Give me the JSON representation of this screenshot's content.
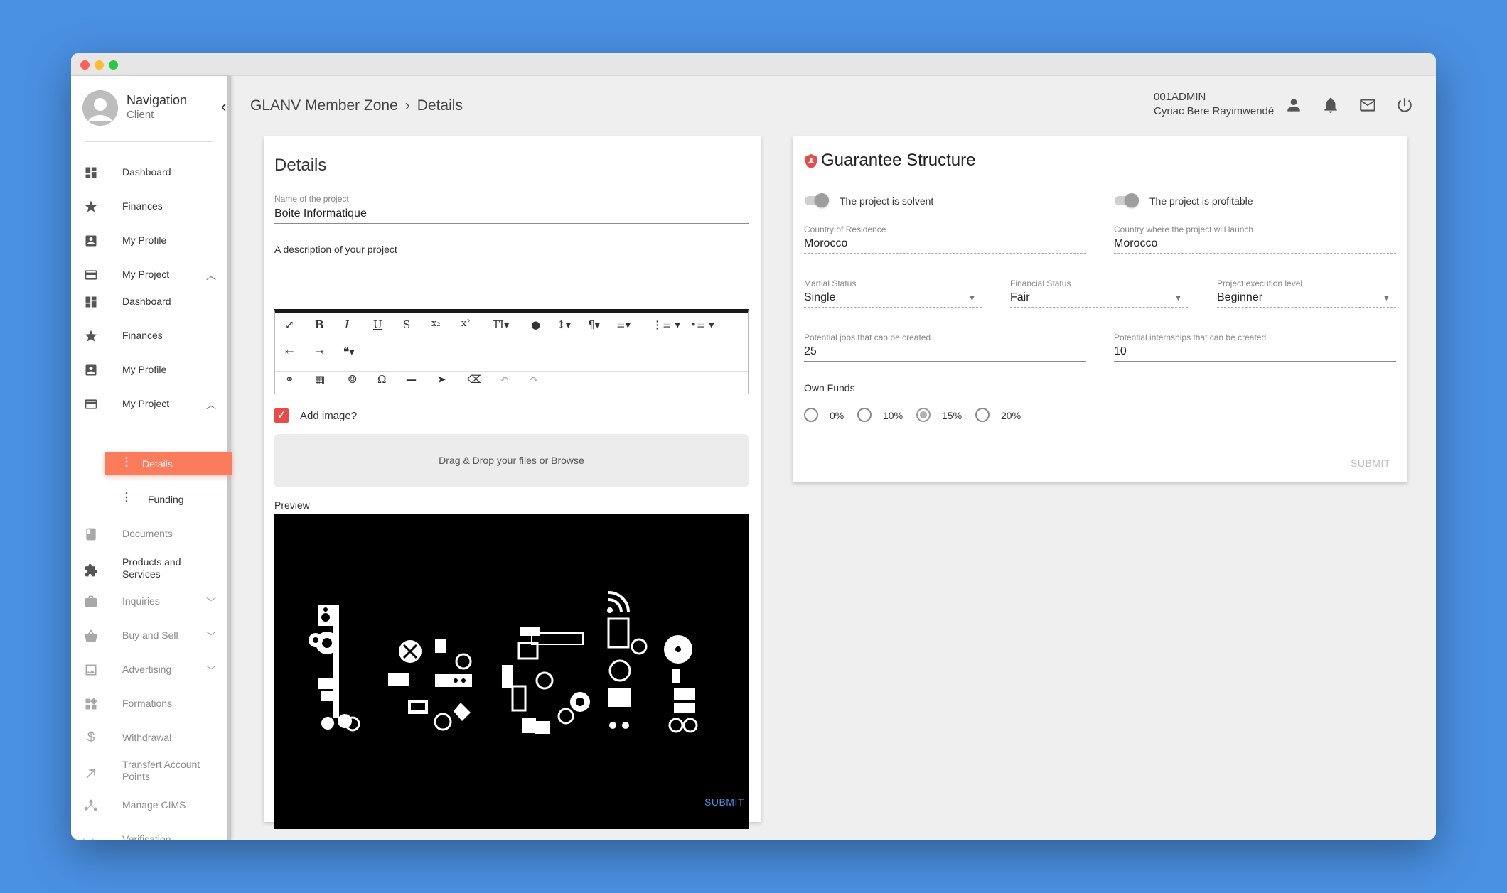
{
  "sidebar": {
    "title": "Navigation",
    "subtitle": "Client",
    "items": [
      {
        "label": "Dashboard",
        "icon": "dashboard-icon"
      },
      {
        "label": "Finances",
        "icon": "star-icon"
      },
      {
        "label": "My Profile",
        "icon": "account-box-icon"
      },
      {
        "label": "My Project",
        "icon": "credit-card-icon"
      },
      {
        "label": "Dashboard",
        "icon": "dashboard-icon"
      },
      {
        "label": "Finances",
        "icon": "star-icon"
      },
      {
        "label": "My Profile",
        "icon": "account-box-icon"
      },
      {
        "label": "My Project",
        "icon": "credit-card-icon"
      },
      {
        "label": "Details",
        "icon": "vertical-dots-icon"
      },
      {
        "label": "Funding",
        "icon": "vertical-dots-icon"
      },
      {
        "label": "Documents",
        "icon": "book-icon"
      },
      {
        "label": "Products and Services",
        "icon": "puzzle-icon"
      },
      {
        "label": "Inquiries",
        "icon": "briefcase-icon"
      },
      {
        "label": "Buy and Sell",
        "icon": "basket-icon"
      },
      {
        "label": "Advertising",
        "icon": "picture-icon"
      },
      {
        "label": "Formations",
        "icon": "widgets-icon"
      },
      {
        "label": "Withdrawal",
        "icon": "dollar-icon"
      },
      {
        "label": "Transfert Account Points",
        "icon": "arrow-up-right-icon"
      },
      {
        "label": "Manage CIMS",
        "icon": "network-icon"
      },
      {
        "label": "Verification",
        "icon": "code-icon"
      }
    ]
  },
  "header": {
    "breadcrumb_root": "GLANV Member Zone",
    "breadcrumb_current": "Details",
    "user_id": "001ADMIN",
    "user_name": "Cyriac Bere Rayimwendé"
  },
  "details": {
    "title": "Details",
    "name_label": "Name of the project",
    "name_value": "Boite Informatique",
    "description_label": "A description of your project",
    "add_image_label": "Add image?",
    "add_image_checked": true,
    "dropzone_text": "Drag & Drop your files or ",
    "dropzone_link": "Browse",
    "preview_label": "Preview",
    "submit_label": "SUBMIT"
  },
  "guarantee": {
    "title": "Guarantee Structure",
    "toggle_solvent": "The project is solvent",
    "toggle_profitable": "The project is profitable",
    "country_residence_label": "Country of Residence",
    "country_residence_value": "Morocco",
    "country_launch_label": "Country where the project will launch",
    "country_launch_value": "Morocco",
    "marital_label": "Martial Status",
    "marital_value": "Single",
    "financial_label": "Financial Status",
    "financial_value": "Fair",
    "execution_label": "Project execution level",
    "execution_value": "Beginner",
    "jobs_label": "Potential jobs that can be created",
    "jobs_value": "25",
    "internships_label": "Potential internships that can be created",
    "internships_value": "10",
    "own_funds_label": "Own Funds",
    "own_funds_options": [
      "0%",
      "10%",
      "15%",
      "20%"
    ],
    "own_funds_selected": "15%",
    "submit_label": "SUBMIT"
  },
  "colors": {
    "accent": "#fa7c5c",
    "link": "#4a90e2",
    "checkbox": "#e94b4b",
    "background": "#4a90e2"
  }
}
